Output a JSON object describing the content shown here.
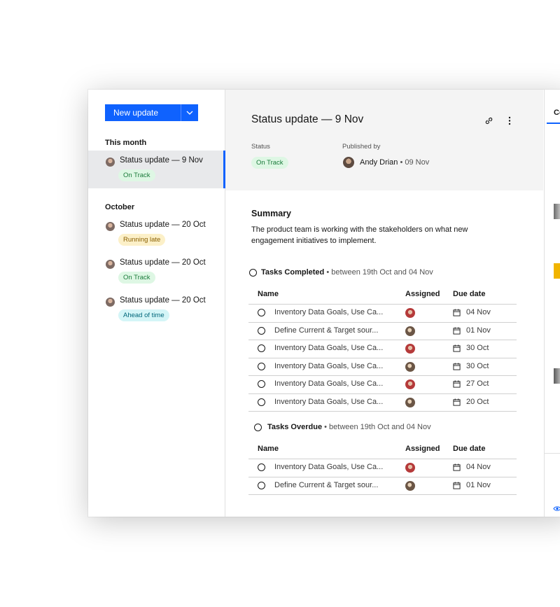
{
  "sidebar": {
    "new_update_label": "New update",
    "sections": [
      {
        "heading": "This month"
      },
      {
        "heading": "October"
      }
    ],
    "items": [
      {
        "title": "Status update — 9 Nov",
        "tag": "On Track"
      },
      {
        "title": "Status update — 20 Oct",
        "tag": "Running late"
      },
      {
        "title": "Status update — 20 Oct",
        "tag": "On Track"
      },
      {
        "title": "Status update — 20 Oct",
        "tag": "Ahead of time"
      }
    ]
  },
  "header": {
    "title": "Status update — 9 Nov",
    "status_label": "Status",
    "status_value": "On Track",
    "published_label": "Published by",
    "publisher": "Andy Drian",
    "published_date": "• 09 Nov",
    "link_icon": "link-icon",
    "menu_icon": "overflow-menu-icon"
  },
  "summary": {
    "title": "Summary",
    "text": "The product team is working with the stakeholders on what new engagement initiatives to implement."
  },
  "tasks_completed": {
    "title": "Tasks Completed",
    "range": "• between 19th Oct and 04 Nov",
    "columns": [
      "Name",
      "Assigned",
      "Due date"
    ],
    "rows": [
      {
        "name": "Inventory Data Goals, Use Ca...",
        "due": "04 Nov"
      },
      {
        "name": "Define Current & Target sour...",
        "due": "01 Nov"
      },
      {
        "name": "Inventory Data Goals, Use Ca...",
        "due": "30 Oct"
      },
      {
        "name": "Inventory Data Goals, Use Ca...",
        "due": "30 Oct"
      },
      {
        "name": "Inventory Data Goals, Use Ca...",
        "due": "27 Oct"
      },
      {
        "name": "Inventory Data Goals, Use Ca...",
        "due": "20 Oct"
      }
    ]
  },
  "tasks_overdue": {
    "title": "Tasks Overdue",
    "range": "• between 19th Oct and 04 Nov",
    "columns": [
      "Name",
      "Assigned",
      "Due date"
    ],
    "rows": [
      {
        "name": "Inventory Data Goals, Use Ca...",
        "due": "04 Nov"
      },
      {
        "name": "Define Current & Target sour...",
        "due": "01 Nov"
      }
    ]
  },
  "right_panel": {
    "tab_label": "Co"
  },
  "colors": {
    "primary": "#0f62fe",
    "on_track": "#def7e4",
    "running_late": "#fcf0c8",
    "ahead_of_time": "#d4f5f7"
  }
}
